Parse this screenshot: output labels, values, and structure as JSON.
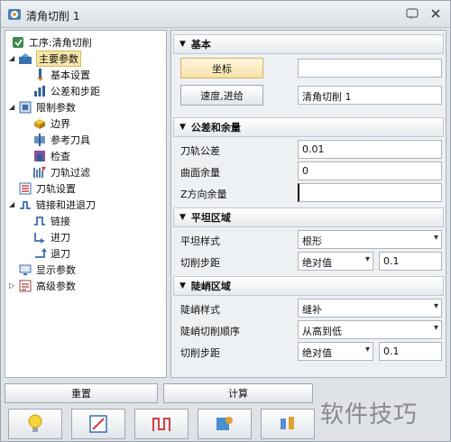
{
  "window": {
    "title": "清角切削 1"
  },
  "tree": {
    "root": "工序:清角切削",
    "items": [
      {
        "label": "主要参数"
      },
      {
        "label": "基本设置"
      },
      {
        "label": "公差和步距"
      },
      {
        "label": "限制参数"
      },
      {
        "label": "边界"
      },
      {
        "label": "参考刀具"
      },
      {
        "label": "检查"
      },
      {
        "label": "刀轨过滤"
      },
      {
        "label": "刀轨设置"
      },
      {
        "label": "链接和进退刀"
      },
      {
        "label": "链接"
      },
      {
        "label": "进刀"
      },
      {
        "label": "退刀"
      },
      {
        "label": "显示参数"
      },
      {
        "label": "高级参数"
      }
    ]
  },
  "sections": {
    "basic": {
      "title": "基本",
      "coord_button": "坐标",
      "coord_value": "",
      "speed_button": "速度,进给",
      "speed_value": "清角切削 1"
    },
    "tolerance": {
      "title": "公差和余量",
      "path_tol_label": "刀轨公差",
      "path_tol_value": "0.01",
      "surface_label": "曲面余量",
      "surface_value": "0",
      "z_label": "Z方向余量",
      "z_value": ""
    },
    "flat": {
      "title": "平坦区域",
      "style_label": "平坦样式",
      "style_value": "根形",
      "step_label": "切削步距",
      "step_mode": "绝对值",
      "step_value": "0.1"
    },
    "steep": {
      "title": "陡峭区域",
      "style_label": "陡峭样式",
      "style_value": "缝补",
      "order_label": "陡峭切削顺序",
      "order_value": "从高到低",
      "step_label": "切削步距",
      "step_mode": "绝对值",
      "step_value": "0.1"
    }
  },
  "bottom": {
    "reset": "重置",
    "calc": "计算"
  },
  "watermark": "软件技巧"
}
